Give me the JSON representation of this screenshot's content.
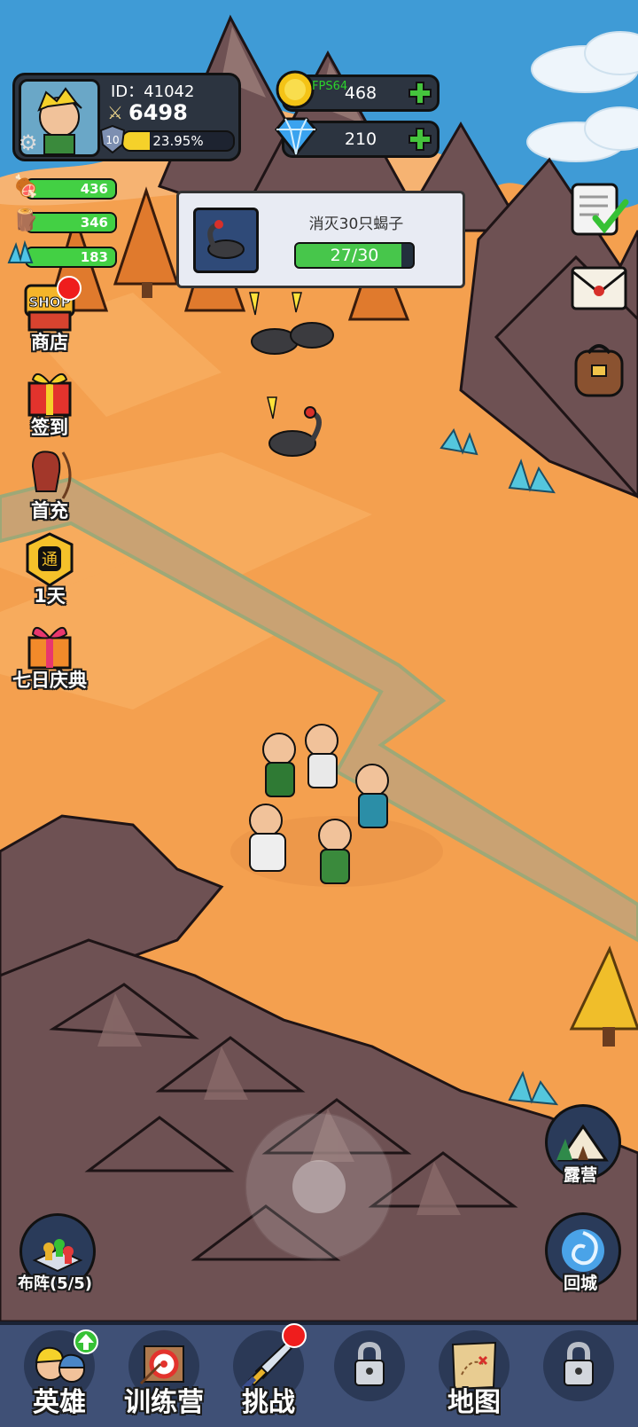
{
  "profile": {
    "id_label": "ID：41042",
    "power": "6498",
    "level": "10",
    "exp_percent": "23.95%",
    "exp_fraction": 0.2395
  },
  "fps_label": "FPS64",
  "currency": {
    "gold": "468",
    "diamond": "210"
  },
  "resources": [
    {
      "icon": "meat-icon",
      "value": "436"
    },
    {
      "icon": "wood-icon",
      "value": "346"
    },
    {
      "icon": "crystal-icon",
      "value": "183"
    }
  ],
  "quest": {
    "title": "消灭30只蝎子",
    "progress": "27/30",
    "progress_fraction": 0.9
  },
  "left_menu": [
    {
      "label": "商店",
      "icon": "shop-icon",
      "badge_text": "SHOP"
    },
    {
      "label": "签到",
      "icon": "gift-box-icon"
    },
    {
      "label": "首充",
      "icon": "archer-girl-icon"
    },
    {
      "label": "1天",
      "icon": "pass-icon",
      "badge_text": "通"
    },
    {
      "label": "七日庆典",
      "icon": "celebration-gift-icon"
    }
  ],
  "right_menu": [
    {
      "icon": "task-checklist-icon"
    },
    {
      "icon": "mail-icon"
    },
    {
      "icon": "backpack-icon"
    }
  ],
  "buttons": {
    "camp": "露营",
    "return_city": "回城",
    "formation": "布阵(5/5)"
  },
  "bottom_nav": [
    {
      "label": "英雄",
      "icon": "heroes-icon",
      "badge": "upgrade"
    },
    {
      "label": "训练营",
      "icon": "target-icon"
    },
    {
      "label": "挑战",
      "icon": "sword-icon",
      "badge": "red-dot"
    },
    {
      "label": "",
      "icon": "lock-icon"
    },
    {
      "label": "地图",
      "icon": "treasure-map-icon"
    },
    {
      "label": "",
      "icon": "lock-icon"
    }
  ],
  "colors": {
    "ground": "#f4a04f",
    "path": "#c9a273",
    "mountain": "#6e5153",
    "sea": "#3f9bd6",
    "progress_green": "#47c64b",
    "exp_yellow": "#f5d12a"
  }
}
